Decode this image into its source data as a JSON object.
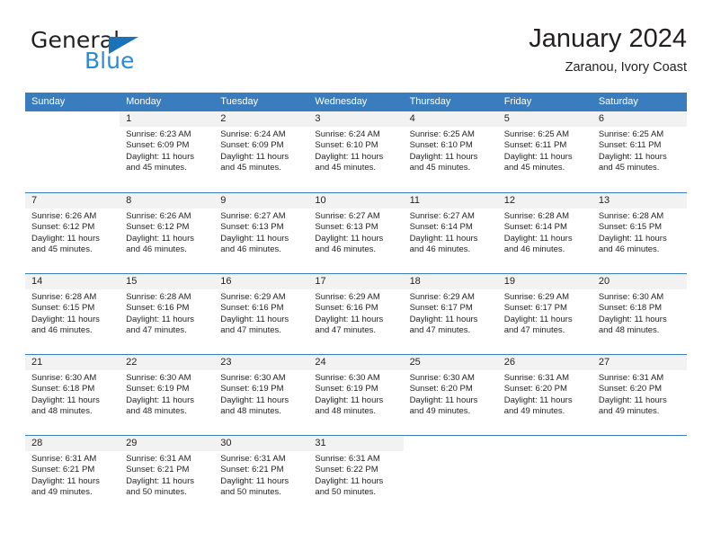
{
  "brand": {
    "name_dark": "General",
    "name_blue": "Blue",
    "accent_color": "#2a8bd5",
    "triangle_color": "#1b72b8"
  },
  "header": {
    "title": "January 2024",
    "subtitle": "Zaranou, Ivory Coast"
  },
  "calendar": {
    "header_bg": "#3a7dbf",
    "daynum_bg": "#f2f2f2",
    "weekdays": [
      "Sunday",
      "Monday",
      "Tuesday",
      "Wednesday",
      "Thursday",
      "Friday",
      "Saturday"
    ],
    "weeks": [
      [
        {
          "day": "",
          "sunrise": "",
          "sunset": "",
          "daylight": "",
          "empty": true
        },
        {
          "day": "1",
          "sunrise": "Sunrise: 6:23 AM",
          "sunset": "Sunset: 6:09 PM",
          "daylight": "Daylight: 11 hours and 45 minutes."
        },
        {
          "day": "2",
          "sunrise": "Sunrise: 6:24 AM",
          "sunset": "Sunset: 6:09 PM",
          "daylight": "Daylight: 11 hours and 45 minutes."
        },
        {
          "day": "3",
          "sunrise": "Sunrise: 6:24 AM",
          "sunset": "Sunset: 6:10 PM",
          "daylight": "Daylight: 11 hours and 45 minutes."
        },
        {
          "day": "4",
          "sunrise": "Sunrise: 6:25 AM",
          "sunset": "Sunset: 6:10 PM",
          "daylight": "Daylight: 11 hours and 45 minutes."
        },
        {
          "day": "5",
          "sunrise": "Sunrise: 6:25 AM",
          "sunset": "Sunset: 6:11 PM",
          "daylight": "Daylight: 11 hours and 45 minutes."
        },
        {
          "day": "6",
          "sunrise": "Sunrise: 6:25 AM",
          "sunset": "Sunset: 6:11 PM",
          "daylight": "Daylight: 11 hours and 45 minutes."
        }
      ],
      [
        {
          "day": "7",
          "sunrise": "Sunrise: 6:26 AM",
          "sunset": "Sunset: 6:12 PM",
          "daylight": "Daylight: 11 hours and 45 minutes."
        },
        {
          "day": "8",
          "sunrise": "Sunrise: 6:26 AM",
          "sunset": "Sunset: 6:12 PM",
          "daylight": "Daylight: 11 hours and 46 minutes."
        },
        {
          "day": "9",
          "sunrise": "Sunrise: 6:27 AM",
          "sunset": "Sunset: 6:13 PM",
          "daylight": "Daylight: 11 hours and 46 minutes."
        },
        {
          "day": "10",
          "sunrise": "Sunrise: 6:27 AM",
          "sunset": "Sunset: 6:13 PM",
          "daylight": "Daylight: 11 hours and 46 minutes."
        },
        {
          "day": "11",
          "sunrise": "Sunrise: 6:27 AM",
          "sunset": "Sunset: 6:14 PM",
          "daylight": "Daylight: 11 hours and 46 minutes."
        },
        {
          "day": "12",
          "sunrise": "Sunrise: 6:28 AM",
          "sunset": "Sunset: 6:14 PM",
          "daylight": "Daylight: 11 hours and 46 minutes."
        },
        {
          "day": "13",
          "sunrise": "Sunrise: 6:28 AM",
          "sunset": "Sunset: 6:15 PM",
          "daylight": "Daylight: 11 hours and 46 minutes."
        }
      ],
      [
        {
          "day": "14",
          "sunrise": "Sunrise: 6:28 AM",
          "sunset": "Sunset: 6:15 PM",
          "daylight": "Daylight: 11 hours and 46 minutes."
        },
        {
          "day": "15",
          "sunrise": "Sunrise: 6:28 AM",
          "sunset": "Sunset: 6:16 PM",
          "daylight": "Daylight: 11 hours and 47 minutes."
        },
        {
          "day": "16",
          "sunrise": "Sunrise: 6:29 AM",
          "sunset": "Sunset: 6:16 PM",
          "daylight": "Daylight: 11 hours and 47 minutes."
        },
        {
          "day": "17",
          "sunrise": "Sunrise: 6:29 AM",
          "sunset": "Sunset: 6:16 PM",
          "daylight": "Daylight: 11 hours and 47 minutes."
        },
        {
          "day": "18",
          "sunrise": "Sunrise: 6:29 AM",
          "sunset": "Sunset: 6:17 PM",
          "daylight": "Daylight: 11 hours and 47 minutes."
        },
        {
          "day": "19",
          "sunrise": "Sunrise: 6:29 AM",
          "sunset": "Sunset: 6:17 PM",
          "daylight": "Daylight: 11 hours and 47 minutes."
        },
        {
          "day": "20",
          "sunrise": "Sunrise: 6:30 AM",
          "sunset": "Sunset: 6:18 PM",
          "daylight": "Daylight: 11 hours and 48 minutes."
        }
      ],
      [
        {
          "day": "21",
          "sunrise": "Sunrise: 6:30 AM",
          "sunset": "Sunset: 6:18 PM",
          "daylight": "Daylight: 11 hours and 48 minutes."
        },
        {
          "day": "22",
          "sunrise": "Sunrise: 6:30 AM",
          "sunset": "Sunset: 6:19 PM",
          "daylight": "Daylight: 11 hours and 48 minutes."
        },
        {
          "day": "23",
          "sunrise": "Sunrise: 6:30 AM",
          "sunset": "Sunset: 6:19 PM",
          "daylight": "Daylight: 11 hours and 48 minutes."
        },
        {
          "day": "24",
          "sunrise": "Sunrise: 6:30 AM",
          "sunset": "Sunset: 6:19 PM",
          "daylight": "Daylight: 11 hours and 48 minutes."
        },
        {
          "day": "25",
          "sunrise": "Sunrise: 6:30 AM",
          "sunset": "Sunset: 6:20 PM",
          "daylight": "Daylight: 11 hours and 49 minutes."
        },
        {
          "day": "26",
          "sunrise": "Sunrise: 6:31 AM",
          "sunset": "Sunset: 6:20 PM",
          "daylight": "Daylight: 11 hours and 49 minutes."
        },
        {
          "day": "27",
          "sunrise": "Sunrise: 6:31 AM",
          "sunset": "Sunset: 6:20 PM",
          "daylight": "Daylight: 11 hours and 49 minutes."
        }
      ],
      [
        {
          "day": "28",
          "sunrise": "Sunrise: 6:31 AM",
          "sunset": "Sunset: 6:21 PM",
          "daylight": "Daylight: 11 hours and 49 minutes."
        },
        {
          "day": "29",
          "sunrise": "Sunrise: 6:31 AM",
          "sunset": "Sunset: 6:21 PM",
          "daylight": "Daylight: 11 hours and 50 minutes."
        },
        {
          "day": "30",
          "sunrise": "Sunrise: 6:31 AM",
          "sunset": "Sunset: 6:21 PM",
          "daylight": "Daylight: 11 hours and 50 minutes."
        },
        {
          "day": "31",
          "sunrise": "Sunrise: 6:31 AM",
          "sunset": "Sunset: 6:22 PM",
          "daylight": "Daylight: 11 hours and 50 minutes."
        },
        {
          "day": "",
          "sunrise": "",
          "sunset": "",
          "daylight": "",
          "empty": true
        },
        {
          "day": "",
          "sunrise": "",
          "sunset": "",
          "daylight": "",
          "empty": true
        },
        {
          "day": "",
          "sunrise": "",
          "sunset": "",
          "daylight": "",
          "empty": true
        }
      ]
    ]
  }
}
